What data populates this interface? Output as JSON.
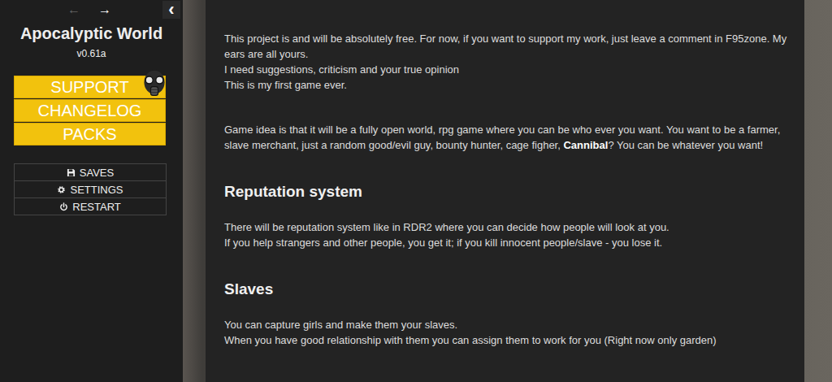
{
  "sidebar": {
    "nav": [
      {
        "label": "←",
        "disabled": true
      },
      {
        "label": "→",
        "disabled": false
      }
    ],
    "toggle": "‹",
    "title": "Apocalyptic World",
    "version": "v0.61a",
    "buttons": [
      "SUPPORT",
      "CHANGELOG",
      "PACKS"
    ],
    "menu": [
      {
        "label": "SAVES"
      },
      {
        "label": "SETTINGS"
      },
      {
        "label": "RESTART"
      }
    ]
  },
  "passage": {
    "intro": [
      [
        [
          {
            "text": "This project is and will be absolutely free. For now, if you want to support my work, just leave a comment in F95zone. My ears are all yours.",
            "bold": false
          }
        ],
        [
          {
            "text": "I need suggestions, criticism and your true opinion",
            "bold": false
          }
        ],
        [
          {
            "text": "This is my first game ever.",
            "bold": false
          }
        ]
      ],
      [
        [
          {
            "text": "Game idea is that it will be a fully open world, rpg game where you can be who ever you want. You want to be a farmer, slave merchant, just a random good/evil guy, bounty hunter, cage figher, ",
            "bold": false
          },
          {
            "text": "Cannibal",
            "bold": true
          },
          {
            "text": "? You can be whatever you want!",
            "bold": false
          }
        ]
      ]
    ],
    "sections": [
      {
        "heading": "Reputation system",
        "paragraphs": [
          [
            [
              {
                "text": "There will be reputation system like in RDR2 where you can decide how people will look at you.",
                "bold": false
              }
            ],
            [
              {
                "text": "If you help strangers and other people, you get it; if you kill innocent people/slave - you lose it.",
                "bold": false
              }
            ]
          ]
        ]
      },
      {
        "heading": "Slaves",
        "paragraphs": [
          [
            [
              {
                "text": "You can capture girls and make them your slaves.",
                "bold": false
              }
            ],
            [
              {
                "text": "When you have good relationship with them you can assign them to work for you (Right now only garden)",
                "bold": false
              }
            ]
          ]
        ]
      }
    ]
  }
}
